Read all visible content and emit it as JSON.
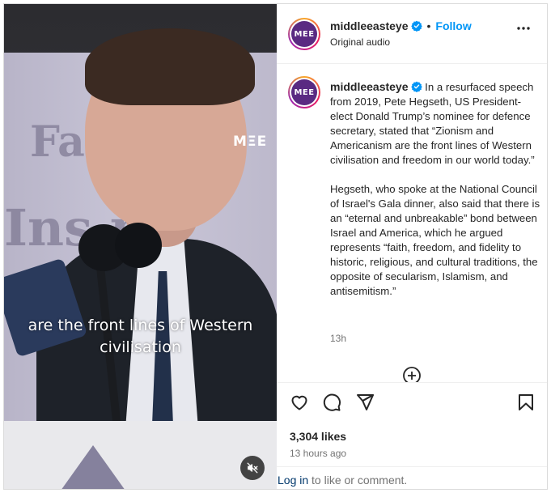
{
  "post": {
    "account": "middleeasteye",
    "avatar_logo": "MEE",
    "follow_label": "Follow",
    "separator": "•",
    "audio": "Original audio",
    "caption_paragraph_1": "In a resurfaced speech from 2019, Pete Hegseth, US President-elect Donald Trump’s nominee for defence secretary, stated that “Zionism and Americanism are the front lines of Western civilisation and freedom in our world today.”",
    "caption_paragraph_2": "Hegseth, who spoke at the National Council of Israel's Gala dinner, also said that there is an “eternal and unbreakable” bond between Israel and America, which he argued represents “faith, freedom, and fidelity to historic, religious, and cultural traditions, the opposite of secularism, Islamism, and antisemitism.”",
    "comment_time": "13h",
    "likes": "3,304 likes",
    "posted_ago": "13 hours ago"
  },
  "video": {
    "watermark": "MΞE",
    "subtitle_line_1": "are the front lines of Western",
    "subtitle_line_2": "civilisation",
    "banner_line_1": "Fa",
    "banner_line_2": "Ins ne"
  },
  "footer": {
    "login_link": "Log in",
    "login_rest": " to like or comment."
  },
  "icons": {
    "verified": "verified-badge-icon",
    "more": "more-options-icon",
    "like": "heart-icon",
    "comment": "comment-bubble-icon",
    "share": "send-paper-plane-icon",
    "save": "bookmark-icon",
    "mute": "muted-speaker-icon",
    "load_more": "plus-circle-icon"
  },
  "colors": {
    "link_blue": "#0095f6",
    "login_link": "#00376b",
    "brand_purple": "#5a2a82"
  }
}
